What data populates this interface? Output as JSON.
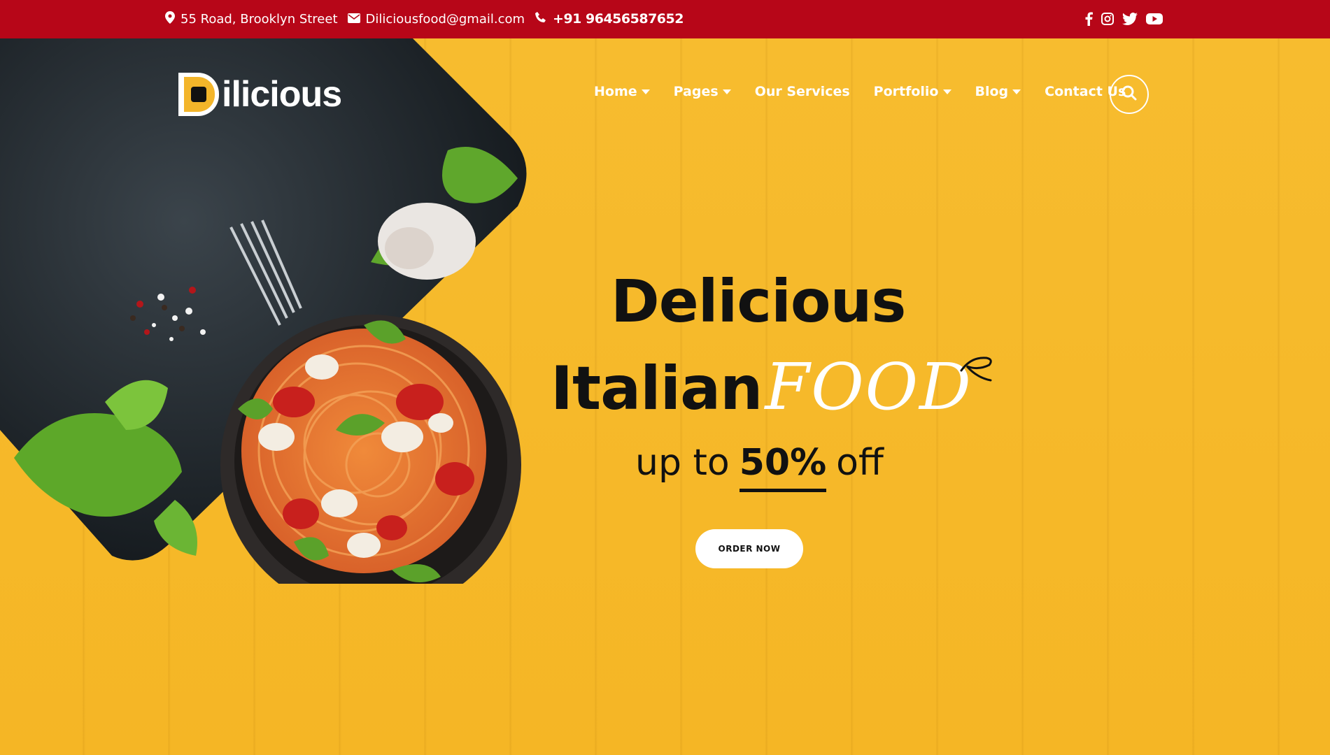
{
  "topbar": {
    "address": "55 Road, Brooklyn Street",
    "email": "Diliciousfood@gmail.com",
    "phone": "+91 96456587652",
    "social_icons": [
      "facebook-icon",
      "instagram-icon",
      "twitter-icon",
      "youtube-icon"
    ]
  },
  "brand": {
    "logo_text": "ilicious",
    "logo_letter": "D"
  },
  "nav": {
    "items": [
      {
        "label": "Home",
        "dropdown": true
      },
      {
        "label": "Pages",
        "dropdown": true
      },
      {
        "label": "Our Services",
        "dropdown": false
      },
      {
        "label": "Portfolio",
        "dropdown": true
      },
      {
        "label": "Blog",
        "dropdown": true
      },
      {
        "label": "Contact Us",
        "dropdown": false
      }
    ],
    "search_icon": "search-icon"
  },
  "hero": {
    "line1": "Delicious",
    "line2": "Italian",
    "script_word": "FOOD",
    "offer_prefix": "up to",
    "offer_pct": "50%",
    "offer_suffix": "off",
    "cta_label": "ORDER NOW"
  },
  "colors": {
    "topbar": "#b70618",
    "background": "#f6b92a",
    "text_dark": "#111111",
    "white": "#ffffff"
  }
}
